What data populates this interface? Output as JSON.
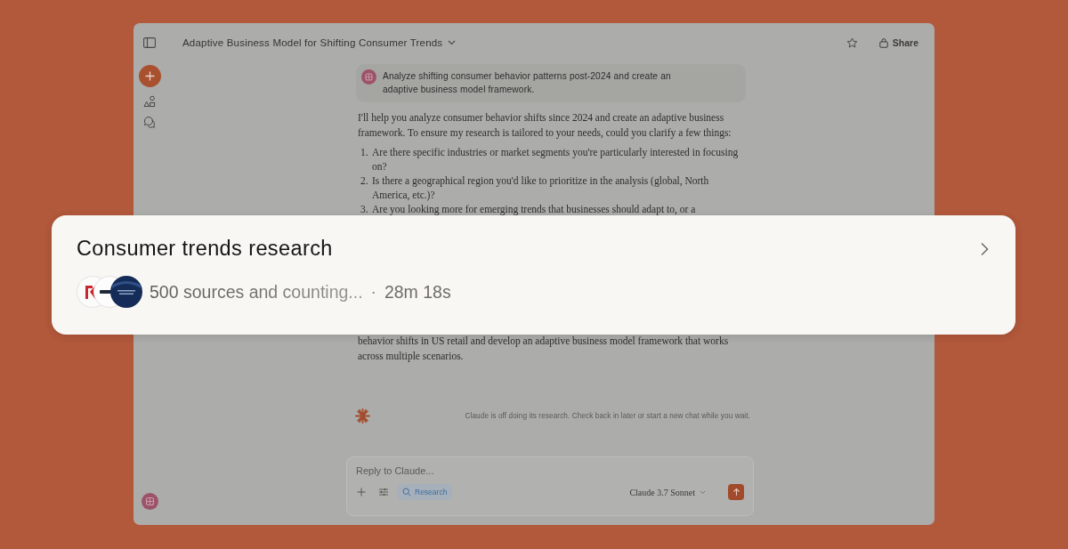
{
  "window": {
    "title": "Adaptive Business Model for Shifting Consumer Trends",
    "share_label": "Share"
  },
  "conversation": {
    "user_message": "Analyze shifting consumer behavior patterns post-2024 and create an adaptive business model framework.",
    "response_intro": "I'll help you analyze consumer behavior shifts since 2024 and create an adaptive business framework. To ensure my research is tailored to your needs, could you clarify a few things:",
    "questions": [
      {
        "number": "1.",
        "text": "Are there specific industries or market segments you're particularly interested in focusing on?"
      },
      {
        "number": "2.",
        "text": "Is there a geographical region you'd like to prioritize in the analysis (global, North America, etc.)?"
      },
      {
        "number": "3.",
        "text": "Are you looking more for emerging trends that businesses should adapt to, or a"
      }
    ],
    "response_continuation": "behavior shifts in US retail and develop an adaptive business model framework that works across multiple scenarios.",
    "status": "Claude is off doing its research. Check back in later or start a new chat while you wait."
  },
  "composer": {
    "placeholder": "Reply to Claude...",
    "tools": [
      {
        "label": "Research",
        "selected": true
      }
    ],
    "model": "Claude 3.7 Sonnet"
  },
  "research_card": {
    "title": "Consumer trends research",
    "progress": "500 sources and counting...",
    "in_progress": true,
    "separator": "·",
    "elapsed": "28m 18s"
  }
}
